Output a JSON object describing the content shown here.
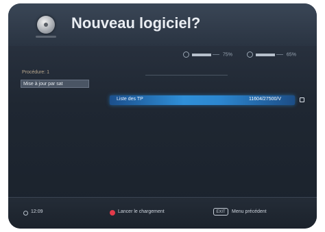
{
  "header": {
    "title": "Nouveau logiciel?",
    "logo_icon": "satellite-dish-icon"
  },
  "signal": {
    "level_percent_label": "75%",
    "level_value": 0.75,
    "quality_percent_label": "65%",
    "quality_value": 0.65
  },
  "sidebar": {
    "line1": "Procédure: 1",
    "button_label": "Mise à jour par sat"
  },
  "list": {
    "row_label": "Liste des TP",
    "row_value": "11604/27500/V",
    "row_icon": "edit-icon"
  },
  "footer": {
    "time": "12:09",
    "red_button_label": "Lancer le chargement",
    "back_button_label": "Menu précédent",
    "back_key": "EXIT"
  },
  "colors": {
    "highlight": "#2f8fd8",
    "red_button": "#e23a4a"
  }
}
